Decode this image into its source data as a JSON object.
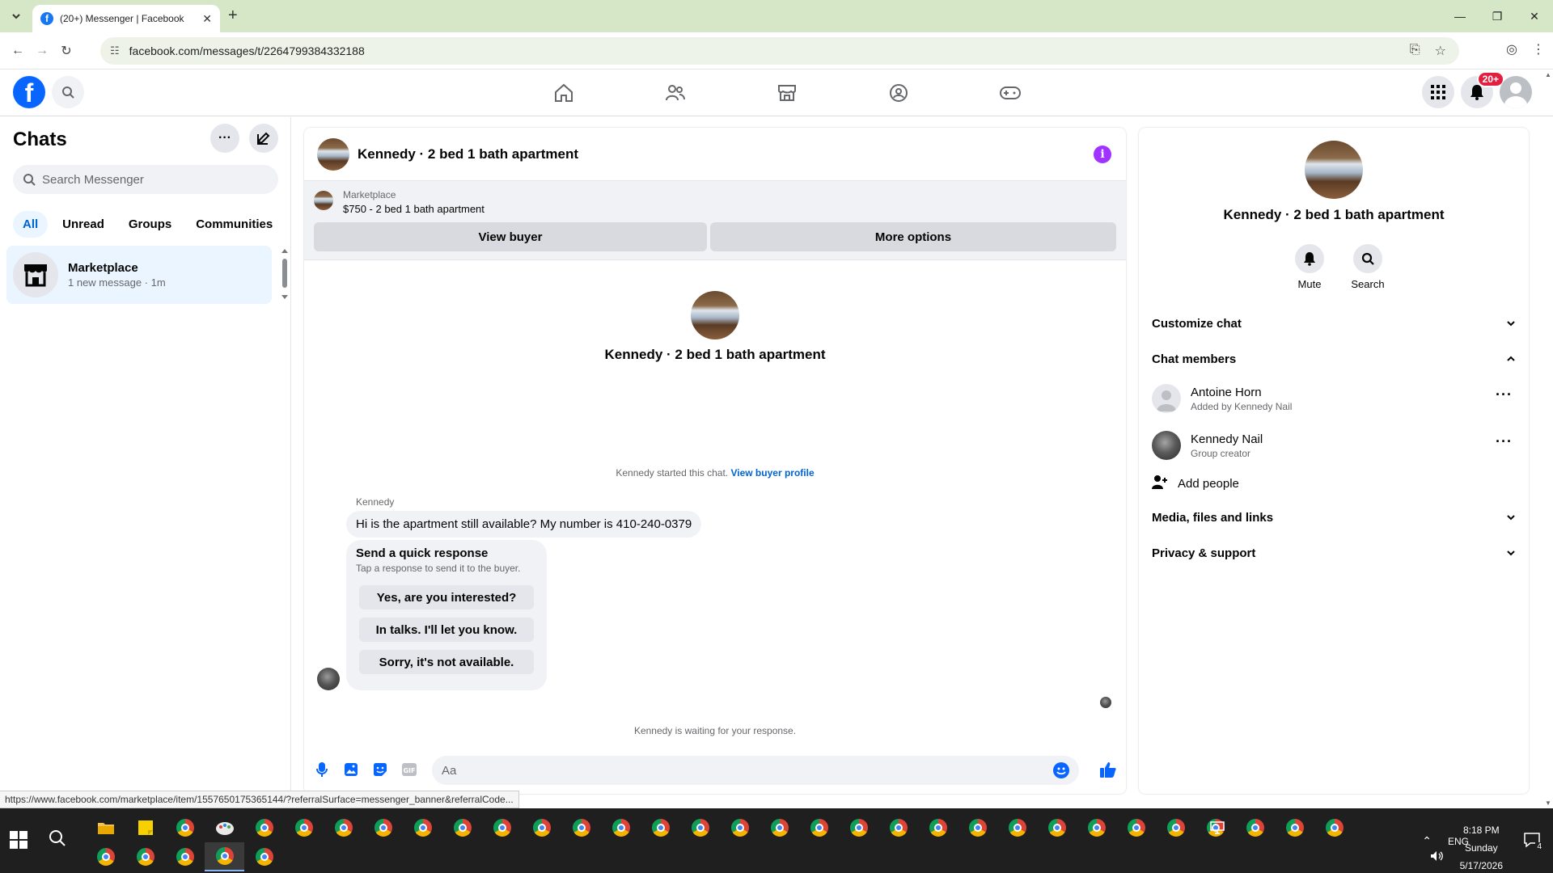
{
  "browser": {
    "tab_title": "(20+) Messenger | Facebook",
    "url": "facebook.com/messages/t/2264799384332188",
    "status_url": "https://www.facebook.com/marketplace/item/1557650175365144/?referralSurface=messenger_banner&referralCode..."
  },
  "header": {
    "notification_badge": "20+",
    "accent": "#0866ff"
  },
  "left": {
    "title": "Chats",
    "search_placeholder": "Search Messenger",
    "filters": [
      "All",
      "Unread",
      "Groups",
      "Communities"
    ],
    "chat": {
      "name": "Marketplace",
      "sub": "1 new message · 1m"
    }
  },
  "conversation": {
    "title": "Kennedy · 2 bed 1 bath apartment",
    "marketplace_label": "Marketplace",
    "listing": "$750 - 2 bed 1 bath apartment",
    "view_buyer": "View buyer",
    "more_options": "More options",
    "intro_title": "Kennedy · 2 bed 1 bath apartment",
    "started_text": "Kennedy started this chat.",
    "view_buyer_profile": "View buyer profile",
    "sender": "Kennedy",
    "message": "Hi is the apartment still available? My number is 410-240-0379",
    "quick_title": "Send a quick response",
    "quick_sub": "Tap a response to send it to the buyer.",
    "quick_replies": [
      "Yes, are you interested?",
      "In talks. I'll let you know.",
      "Sorry, it's not available."
    ],
    "waiting": "Kennedy is waiting for your response.",
    "composer_placeholder": "Aa"
  },
  "details": {
    "title": "Kennedy · 2 bed 1 bath apartment",
    "mute": "Mute",
    "search": "Search",
    "customize": "Customize chat",
    "members_heading": "Chat members",
    "members": [
      {
        "name": "Antoine Horn",
        "sub": "Added by Kennedy Nail"
      },
      {
        "name": "Kennedy Nail",
        "sub": "Group creator"
      }
    ],
    "add_people": "Add people",
    "media": "Media, files and links",
    "privacy": "Privacy & support"
  },
  "taskbar": {
    "lang": "ENG",
    "time": "8:18 PM",
    "day": "Sunday",
    "date": "5/17/2026",
    "notif_count": "4"
  }
}
